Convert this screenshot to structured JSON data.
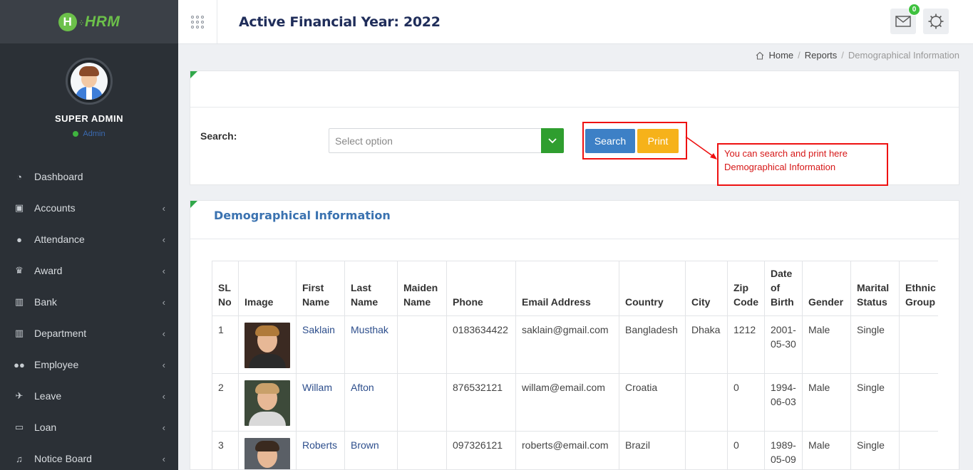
{
  "app": {
    "logo_letter": "H",
    "logo_dots": "·:·",
    "logo_text": "HRM"
  },
  "profile": {
    "name": "SUPER ADMIN",
    "status": "Admin"
  },
  "menu": [
    {
      "label": "Dashboard",
      "icon": "dashboard-icon",
      "has_submenu": false
    },
    {
      "label": "Accounts",
      "icon": "briefcase-icon",
      "has_submenu": true
    },
    {
      "label": "Attendance",
      "icon": "user-icon",
      "has_submenu": true
    },
    {
      "label": "Award",
      "icon": "trophy-icon",
      "has_submenu": true
    },
    {
      "label": "Bank",
      "icon": "bank-icon",
      "has_submenu": true
    },
    {
      "label": "Department",
      "icon": "bank-icon",
      "has_submenu": true
    },
    {
      "label": "Employee",
      "icon": "users-icon",
      "has_submenu": true
    },
    {
      "label": "Leave",
      "icon": "plane-icon",
      "has_submenu": true
    },
    {
      "label": "Loan",
      "icon": "money-icon",
      "has_submenu": true
    },
    {
      "label": "Notice Board",
      "icon": "bell-icon",
      "has_submenu": true
    }
  ],
  "header": {
    "title": "Active Financial Year: 2022",
    "mail_count": "0"
  },
  "breadcrumb": {
    "home": "Home",
    "reports": "Reports",
    "current": "Demographical Information"
  },
  "search": {
    "label": "Search:",
    "placeholder": "Select option",
    "search_button": "Search",
    "print_button": "Print"
  },
  "callout": {
    "line1": "You can search and print here",
    "line2": "Demographical Information"
  },
  "section": {
    "title": "Demographical Information"
  },
  "table": {
    "headers": [
      [
        "SL",
        "No"
      ],
      [
        "Image"
      ],
      [
        "First",
        "Name"
      ],
      [
        "Last",
        "Name"
      ],
      [
        "Maiden",
        "Name"
      ],
      [
        "Phone"
      ],
      [
        "Email Address"
      ],
      [
        "Country"
      ],
      [
        "City"
      ],
      [
        "Zip",
        "Code"
      ],
      [
        "Date",
        "of",
        "Birth"
      ],
      [
        "Gender"
      ],
      [
        "Marital",
        "Status"
      ],
      [
        "Ethnic",
        "Group"
      ]
    ],
    "rows": [
      {
        "sl": "1",
        "first": "Saklain",
        "last": "Musthak",
        "maiden": "",
        "phone": "0183634422",
        "email": "saklain@gmail.com",
        "country": "Bangladesh",
        "city": "Dhaka",
        "zip": "1212",
        "dob": [
          "2001-",
          "05-30"
        ],
        "gender": "Male",
        "marital": "Single",
        "ethnic": ""
      },
      {
        "sl": "2",
        "first": "Willam",
        "last": "Afton",
        "maiden": "",
        "phone": "876532121",
        "email": "willam@email.com",
        "country": "Croatia",
        "city": "",
        "zip": "0",
        "dob": [
          "1994-",
          "06-03"
        ],
        "gender": "Male",
        "marital": "Single",
        "ethnic": ""
      },
      {
        "sl": "3",
        "first": "Roberts",
        "last": "Brown",
        "maiden": "",
        "phone": "097326121",
        "email": "roberts@email.com",
        "country": "Brazil",
        "city": "",
        "zip": "0",
        "dob": [
          "1989-",
          "05-09"
        ],
        "gender": "Male",
        "marital": "Single",
        "ethnic": ""
      }
    ]
  },
  "colors": {
    "accent_green": "#3fc13f",
    "callout_red": "#e11111",
    "search_blue": "#3d80c6",
    "print_yellow": "#f6b21a",
    "sidebar_bg": "#2b3036"
  }
}
